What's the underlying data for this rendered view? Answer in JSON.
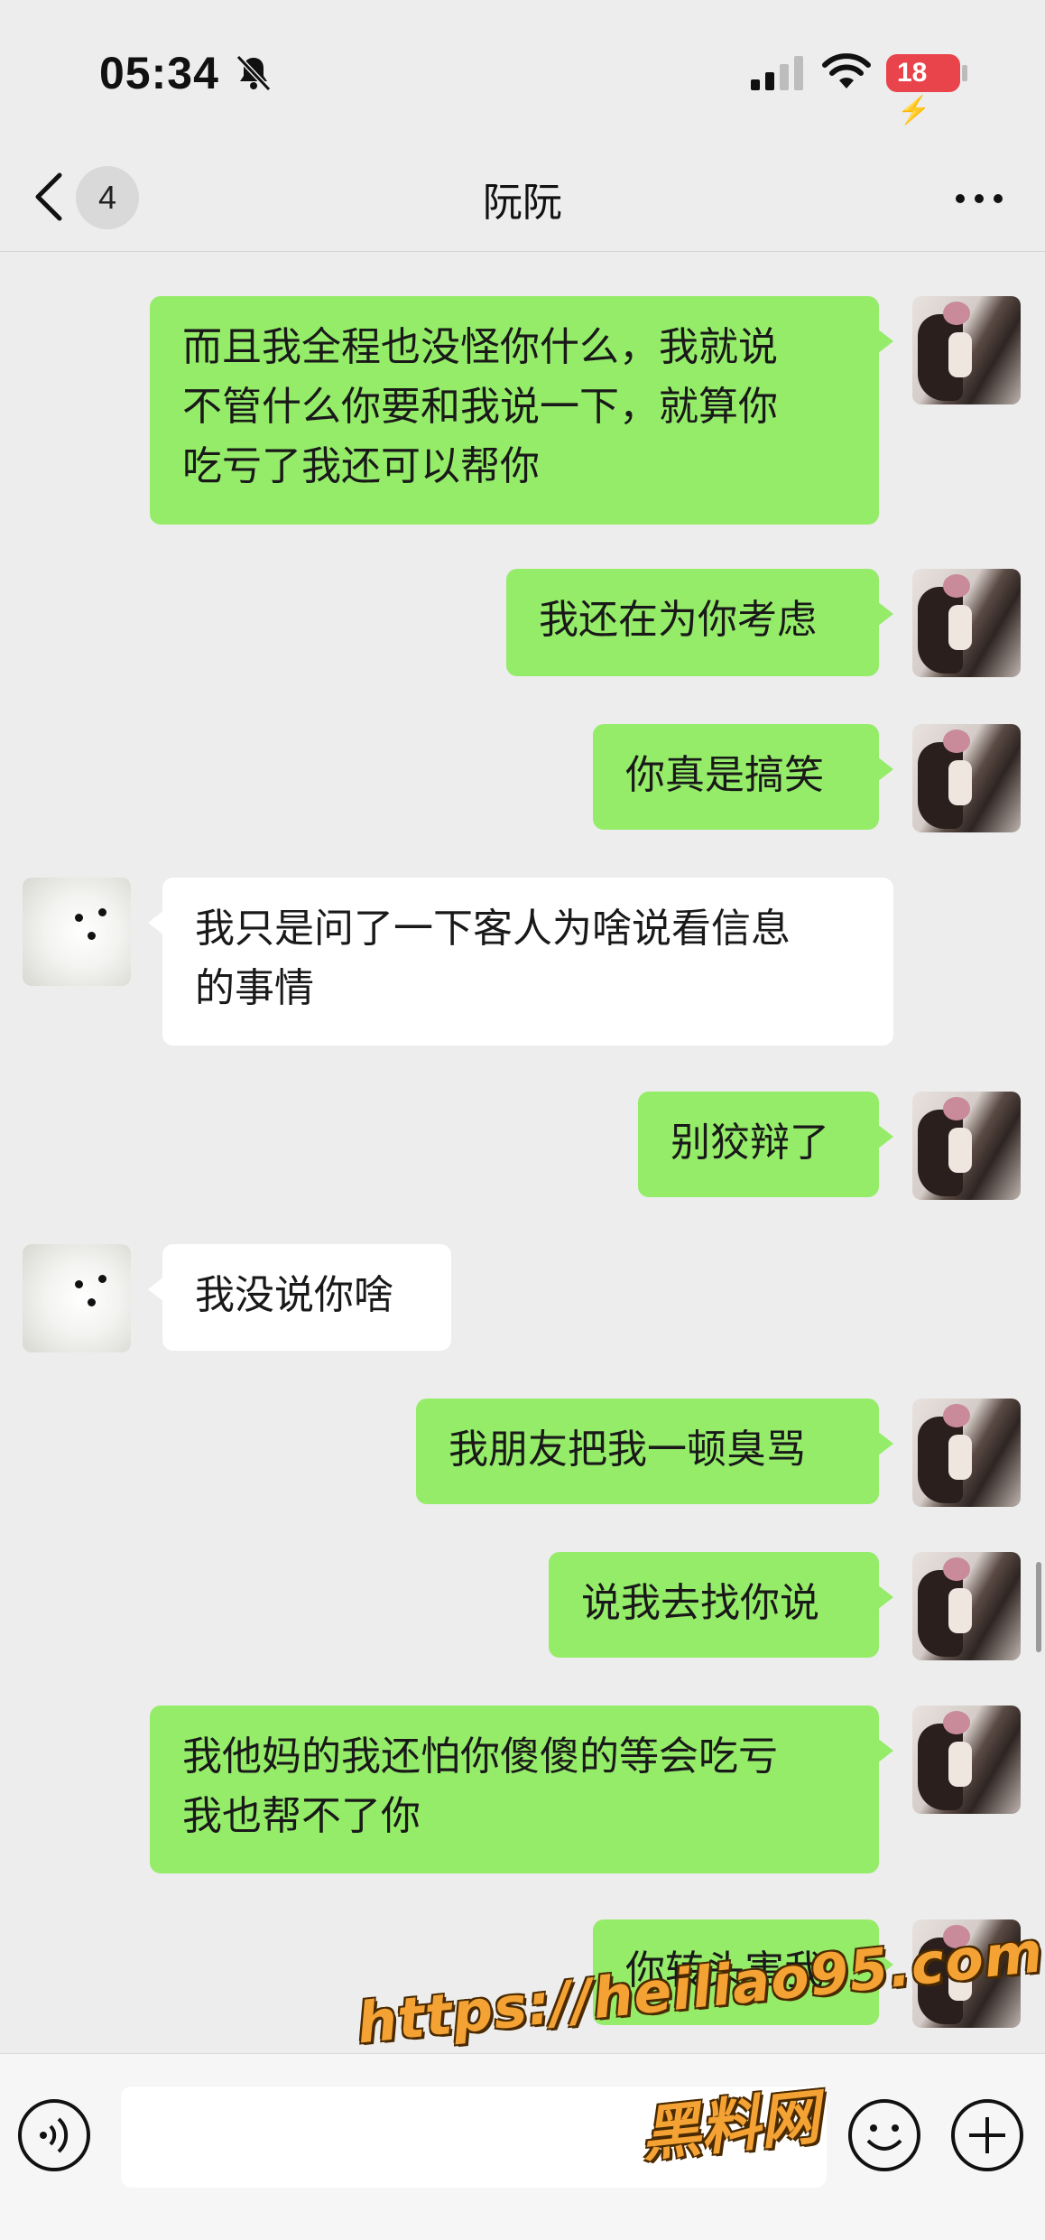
{
  "status_bar": {
    "time": "05:34",
    "battery_label": "18"
  },
  "nav": {
    "unread_count": "4",
    "title": "阮阮"
  },
  "messages": [
    {
      "side": "out",
      "text": "而且我全程也没怪你什么，我就说\n不管什么你要和我说一下，就算你\n吃亏了我还可以帮你"
    },
    {
      "side": "out",
      "text": "我还在为你考虑"
    },
    {
      "side": "out",
      "text": "你真是搞笑"
    },
    {
      "side": "in",
      "text": "我只是问了一下客人为啥说看信息\n的事情"
    },
    {
      "side": "out",
      "text": "别狡辩了"
    },
    {
      "side": "in",
      "text": "我没说你啥"
    },
    {
      "side": "out",
      "text": "我朋友把我一顿臭骂"
    },
    {
      "side": "out",
      "text": "说我去找你说"
    },
    {
      "side": "out",
      "text": "我他妈的我还怕你傻傻的等会吃亏\n我也帮不了你"
    },
    {
      "side": "out",
      "text": "你转头害我"
    }
  ],
  "input_bar": {
    "text_value": ""
  },
  "watermark": {
    "url": "https://heiliao95.com",
    "name": "黑料网"
  },
  "colors": {
    "outgoing_bubble": "#95ec69",
    "incoming_bubble": "#ffffff",
    "background": "#ededed",
    "battery": "#e9444b"
  },
  "icons": [
    "bell-slash-icon",
    "signal-icon",
    "wifi-icon",
    "battery-icon",
    "back-chevron-icon",
    "more-icon",
    "voice-icon",
    "emoji-icon",
    "plus-icon"
  ]
}
